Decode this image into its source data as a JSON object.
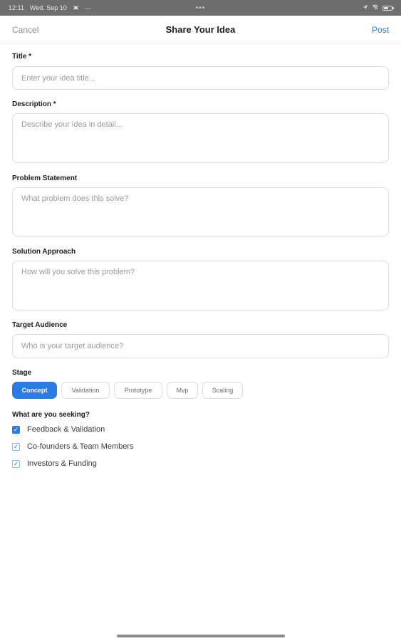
{
  "status_bar": {
    "time": "12:11",
    "date": "Wed, Sep 10",
    "center": "•••",
    "left_icons": [
      "bug-icon",
      "more-icon"
    ],
    "right_icons": [
      "location-icon",
      "wifi-off-icon",
      "battery-icon"
    ]
  },
  "nav": {
    "cancel_label": "Cancel",
    "title": "Share Your Idea",
    "post_label": "Post"
  },
  "form": {
    "title": {
      "label": "Title *",
      "placeholder": "Enter your idea title...",
      "value": ""
    },
    "description": {
      "label": "Description *",
      "placeholder": "Describe your idea in detail...",
      "value": ""
    },
    "problem": {
      "label": "Problem Statement",
      "placeholder": "What problem does this solve?",
      "value": ""
    },
    "solution": {
      "label": "Solution Approach",
      "placeholder": "How will you solve this problem?",
      "value": ""
    },
    "audience": {
      "label": "Target Audience",
      "placeholder": "Who is your target audience?",
      "value": ""
    },
    "stage": {
      "label": "Stage",
      "options": [
        "Concept",
        "Validation",
        "Prototype",
        "Mvp",
        "Scaling"
      ],
      "selected": "Concept"
    },
    "seeking": {
      "label": "What are you seeking?",
      "options": [
        {
          "label": "Feedback & Validation",
          "checked": true
        },
        {
          "label": "Co-founders & Team Members",
          "checked": true
        },
        {
          "label": "Investors & Funding",
          "checked": true
        }
      ]
    }
  },
  "colors": {
    "accent": "#2a7be4",
    "status_bar_bg": "#6d6d6d",
    "border": "#dcdcdf",
    "placeholder": "#9a9a9e"
  }
}
